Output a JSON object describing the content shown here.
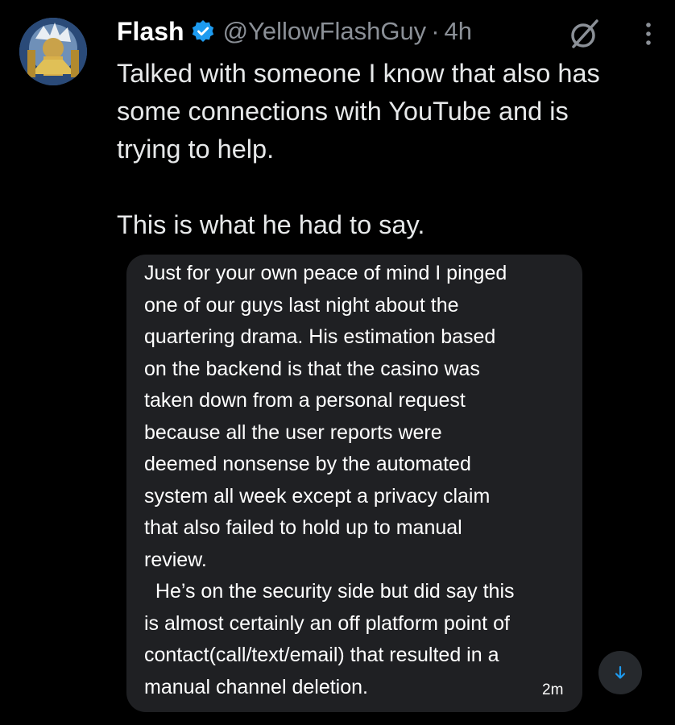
{
  "tweet": {
    "author_name": "Flash",
    "handle": "@YellowFlashGuy",
    "separator": "·",
    "time": "4h",
    "text": "Talked with someone I know that also has\nsome connections with YouTube and is\ntrying to help.\n\nThis is what he had to say."
  },
  "message": {
    "text": "Just for your own peace of mind I pinged\none of our guys last night about the\nquartering drama. His estimation based\non the backend is that the casino was\ntaken down from a personal request\nbecause all the user reports were\ndeemed nonsense by the automated\nsystem all week except a privacy claim\nthat also failed to hold up to manual\nreview.\n  He’s on the security side but did say this\nis almost certainly an off platform point of\ncontact(call/text/email) that resulted in a\nmanual channel deletion.",
    "time": "2m"
  },
  "icons": {
    "verified": "verified-badge-icon",
    "grok": "grok-icon",
    "more": "more-vertical-icon",
    "scroll_down": "arrow-down-icon"
  },
  "colors": {
    "background": "#000000",
    "verified": "#1d9bf0",
    "secondary_text": "#8b9097",
    "card_bg": "#1f2023",
    "scroll_arrow": "#1d9bf0"
  }
}
